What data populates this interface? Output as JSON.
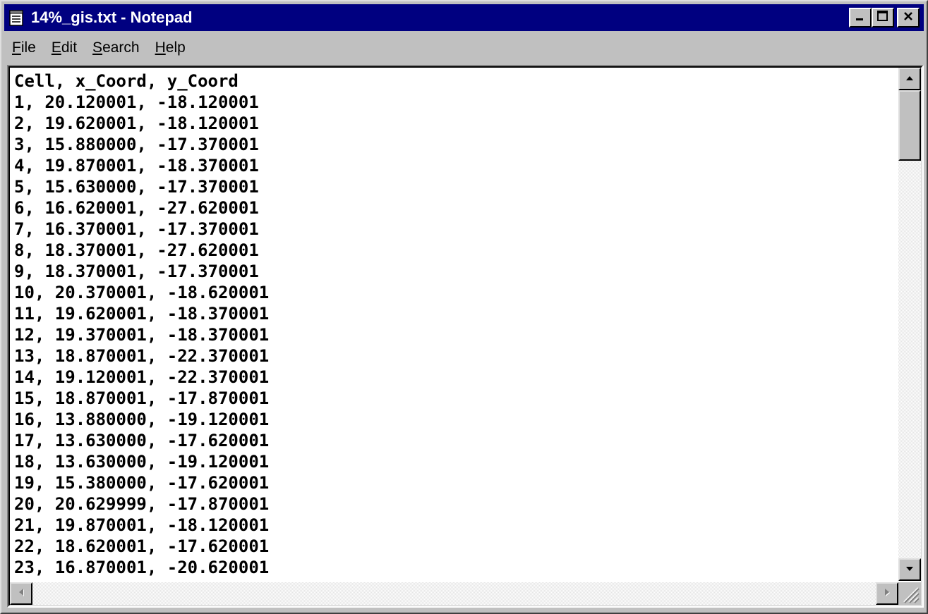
{
  "window": {
    "title": "14%_gis.txt - Notepad",
    "app_icon": "notepad-icon"
  },
  "caption_buttons": {
    "minimize": "minimize-icon",
    "maximize": "maximize-icon",
    "close": "close-icon"
  },
  "menu": [
    {
      "mnemonic": "F",
      "rest": "ile"
    },
    {
      "mnemonic": "E",
      "rest": "dit"
    },
    {
      "mnemonic": "S",
      "rest": "earch"
    },
    {
      "mnemonic": "H",
      "rest": "elp"
    }
  ],
  "document": {
    "lines": [
      "Cell, x_Coord, y_Coord",
      "1, 20.120001, -18.120001",
      "2, 19.620001, -18.120001",
      "3, 15.880000, -17.370001",
      "4, 19.870001, -18.370001",
      "5, 15.630000, -17.370001",
      "6, 16.620001, -27.620001",
      "7, 16.370001, -17.370001",
      "8, 18.370001, -27.620001",
      "9, 18.370001, -17.370001",
      "10, 20.370001, -18.620001",
      "11, 19.620001, -18.370001",
      "12, 19.370001, -18.370001",
      "13, 18.870001, -22.370001",
      "14, 19.120001, -22.370001",
      "15, 18.870001, -17.870001",
      "16, 13.880000, -19.120001",
      "17, 13.630000, -17.620001",
      "18, 13.630000, -19.120001",
      "19, 15.380000, -17.620001",
      "20, 20.629999, -17.870001",
      "21, 19.870001, -18.120001",
      "22, 18.620001, -17.620001",
      "23, 16.870001, -20.620001"
    ]
  },
  "colors": {
    "titlebar": "#000080",
    "face": "#c0c0c0",
    "text_bg": "#ffffff"
  }
}
